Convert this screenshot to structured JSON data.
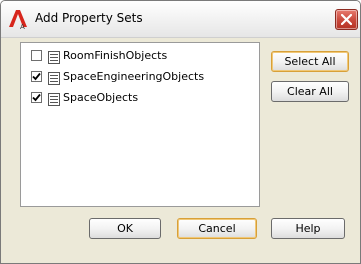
{
  "window": {
    "title": "Add Property Sets"
  },
  "list": {
    "items": [
      {
        "label": "RoomFinishObjects",
        "checked": false
      },
      {
        "label": "SpaceEngineeringObjects",
        "checked": true
      },
      {
        "label": "SpaceObjects",
        "checked": true
      }
    ]
  },
  "buttons": {
    "select_all": "Select All",
    "clear_all": "Clear All",
    "ok": "OK",
    "cancel": "Cancel",
    "help": "Help"
  },
  "colors": {
    "app_icon_red": "#d7261c",
    "close_button": "#c8473a",
    "default_button_border": "#d8a039"
  },
  "icons": {
    "app": "autocad-a-icon",
    "close": "close-icon",
    "list_item": "property-set-icon",
    "check": "checkmark-icon"
  }
}
